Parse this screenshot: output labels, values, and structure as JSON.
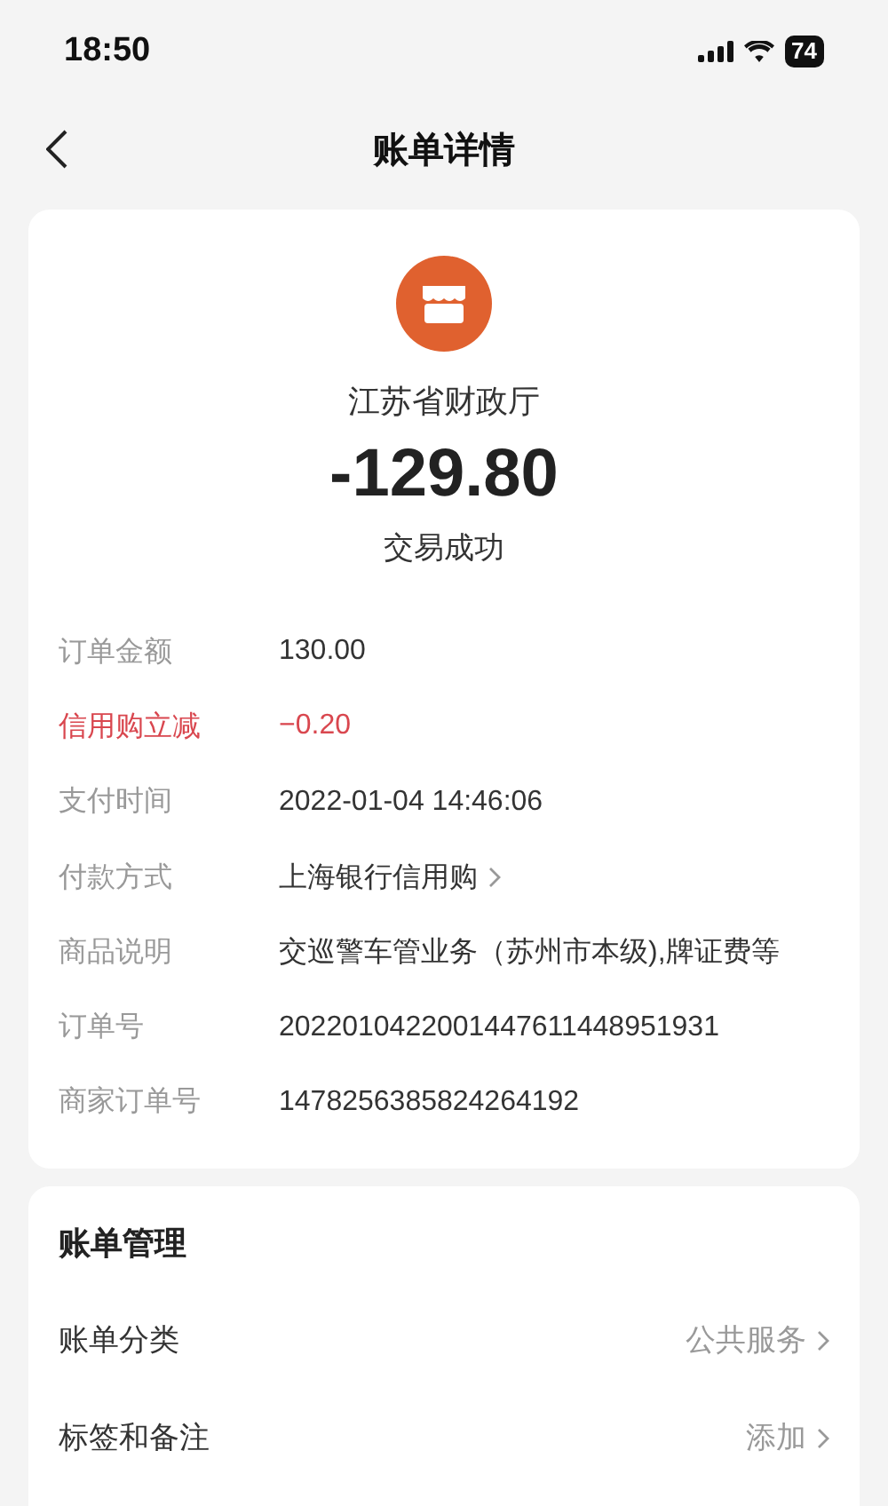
{
  "status_bar": {
    "time": "18:50",
    "battery": "74"
  },
  "nav": {
    "title": "账单详情"
  },
  "summary": {
    "merchant": "江苏省财政厅",
    "amount": "-129.80",
    "status": "交易成功"
  },
  "details": [
    {
      "label": "订单金额",
      "value": "130.00",
      "highlight": false,
      "link": false
    },
    {
      "label": "信用购立减",
      "value": "−0.20",
      "highlight": true,
      "link": false
    },
    {
      "label": "支付时间",
      "value": "2022-01-04 14:46:06",
      "highlight": false,
      "link": false
    },
    {
      "label": "付款方式",
      "value": "上海银行信用购",
      "highlight": false,
      "link": true
    },
    {
      "label": "商品说明",
      "value": "交巡警车管业务（苏州市本级),牌证费等",
      "highlight": false,
      "link": false
    },
    {
      "label": "订单号",
      "value": "2022010422001447611448951931",
      "highlight": false,
      "link": false
    },
    {
      "label": "商家订单号",
      "value": "1478256385824264192",
      "highlight": false,
      "link": false
    }
  ],
  "management": {
    "title": "账单管理",
    "items": [
      {
        "label": "账单分类",
        "value": "公共服务"
      },
      {
        "label": "标签和备注",
        "value": "添加"
      }
    ]
  }
}
